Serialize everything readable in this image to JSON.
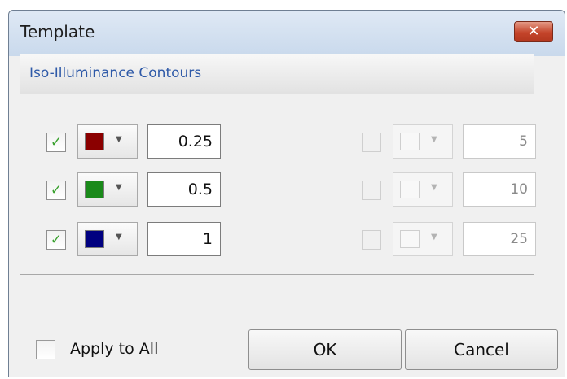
{
  "window": {
    "title": "Template",
    "close_glyph": "✕",
    "close_icon": "close-icon"
  },
  "group": {
    "title": "Iso-Illuminance Contours",
    "left_rows": [
      {
        "checked": true,
        "color": "#8b0000",
        "value": "0.25"
      },
      {
        "checked": true,
        "color": "#1a8a1a",
        "value": "0.5"
      },
      {
        "checked": true,
        "color": "#000080",
        "value": "1"
      }
    ],
    "right_rows": [
      {
        "checked": false,
        "color": null,
        "value": "5"
      },
      {
        "checked": false,
        "color": null,
        "value": "10"
      },
      {
        "checked": false,
        "color": null,
        "value": "25"
      }
    ]
  },
  "check_glyph": "✓",
  "dropdown_glyph": "▼",
  "footer": {
    "apply_label": "Apply to All",
    "apply_checked": false,
    "ok_label": "OK",
    "cancel_label": "Cancel"
  }
}
